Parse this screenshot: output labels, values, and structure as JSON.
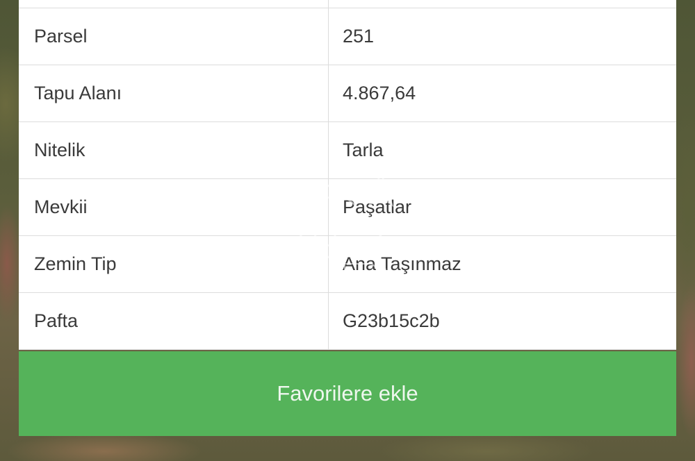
{
  "table": {
    "rows": [
      {
        "label": "Parsel",
        "value": "251"
      },
      {
        "label": "Tapu Alanı",
        "value": "4.867,64"
      },
      {
        "label": "Nitelik",
        "value": "Tarla"
      },
      {
        "label": "Mevkii",
        "value": "Paşatlar"
      },
      {
        "label": "Zemin Tip",
        "value": "Ana Taşınmaz"
      },
      {
        "label": "Pafta",
        "value": "G23b15c2b"
      }
    ]
  },
  "favorite_button": {
    "label": "Favorilere ekle",
    "color": "#55b35a"
  },
  "watermark": {
    "icon": "cb-star-logo-icon"
  }
}
